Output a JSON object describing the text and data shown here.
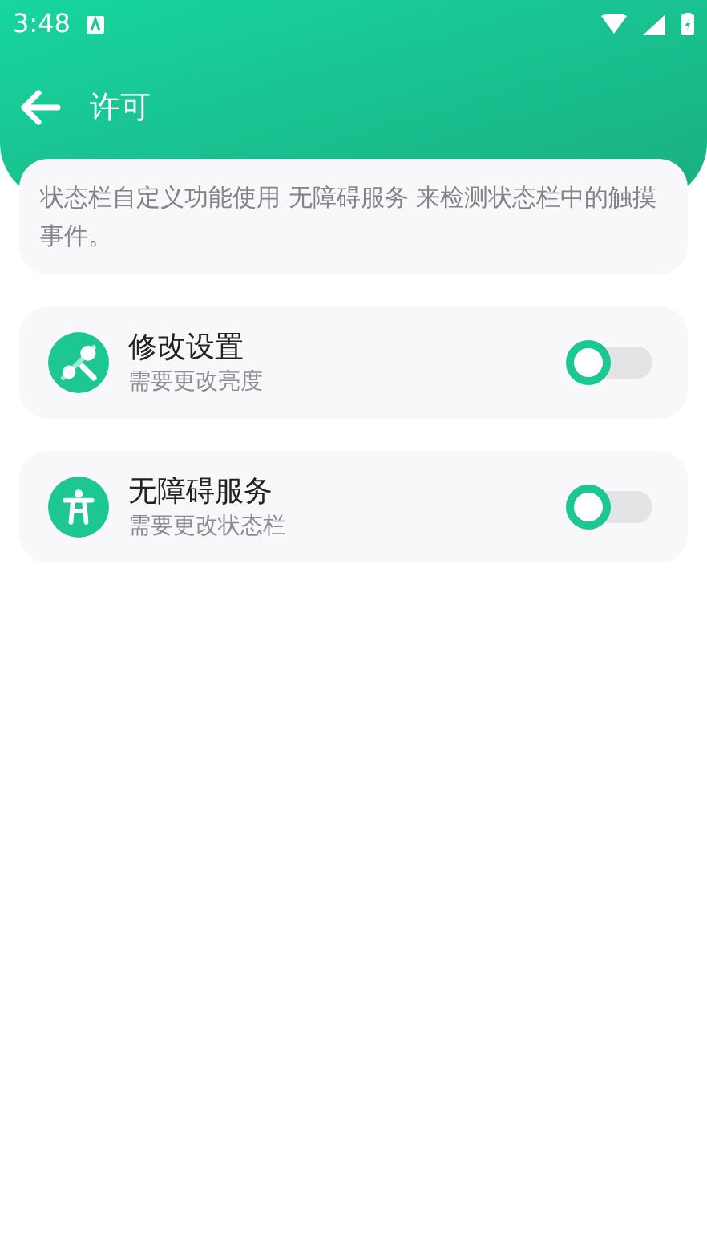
{
  "status_bar": {
    "time": "3:48"
  },
  "toolbar": {
    "title": "许可"
  },
  "info": "状态栏自定义功能使用 无障碍服务 来检测状态栏中的触摸事件。",
  "permissions": [
    {
      "title": "修改设置",
      "subtitle": "需要更改亮度",
      "on": false
    },
    {
      "title": "无障碍服务",
      "subtitle": "需要更改状态栏",
      "on": false
    }
  ]
}
